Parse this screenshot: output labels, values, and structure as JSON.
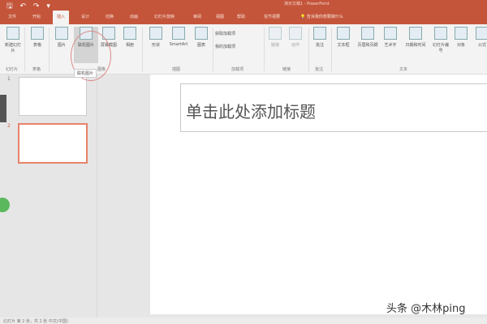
{
  "app": {
    "title": "演示文稿1 - PowerPoint",
    "qat": "🖫 ↶ ↷ ▾"
  },
  "tabs": [
    "文件",
    "开始",
    "插入",
    "设计",
    "切换",
    "动画",
    "幻灯片放映",
    "审阅",
    "视图",
    "帮助",
    "信节视要"
  ],
  "tell_me": "告诉我你想要做什么",
  "ribbon": {
    "buttons": [
      "新建幻灯片",
      "表格",
      "图片",
      "联机图片",
      "屏幕截图",
      "相册",
      "形状",
      "SmartArt",
      "图表",
      "链接",
      "动作",
      "批注",
      "文本框",
      "页眉和页脚",
      "艺术字",
      "日期和时间",
      "幻灯片编号",
      "对象",
      "公式"
    ],
    "addins": [
      "获取加载项",
      "我的加载项"
    ],
    "groups": [
      "幻灯片",
      "表格",
      "图像",
      "插图",
      "加载项",
      "链接",
      "批注",
      "文本"
    ]
  },
  "tooltip": "联机图片",
  "slides": {
    "numbers": [
      "1",
      "2"
    ]
  },
  "slide": {
    "title_placeholder": "单击此处添加标题"
  },
  "watermark": "头条 @木林ping",
  "status": "幻灯片 第 2 张，共 2 张  中文(中国)"
}
